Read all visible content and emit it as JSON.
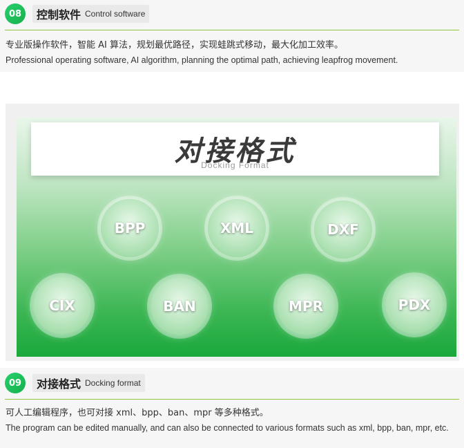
{
  "section1": {
    "number": "08",
    "title_cn": "控制软件",
    "title_en": "Control software",
    "desc_cn": "专业版操作软件，智能 AI 算法，规划最优路径，实现蛙跳式移动，最大化加工效率。",
    "desc_en": "Professional operating software, AI algorithm, planning the optimal path, achieving leapfrog movement."
  },
  "banner": {
    "title": "对接格式",
    "subtitle": "Docking Format",
    "formats": [
      "BPP",
      "XML",
      "DXF",
      "CIX",
      "BAN",
      "MPR",
      "PDX"
    ]
  },
  "section2": {
    "number": "09",
    "title_cn": "对接格式",
    "title_en": "Docking format",
    "desc_cn": "可人工编辑程序，也可对接 xml、bpp、ban、mpr 等多种格式。",
    "desc_en": "The program can be edited manually, and can also be connected to various formats such as xml, bpp, ban, mpr, etc."
  },
  "colors": {
    "accent_green": "#16b04e",
    "rule_green": "#8cc63f"
  }
}
